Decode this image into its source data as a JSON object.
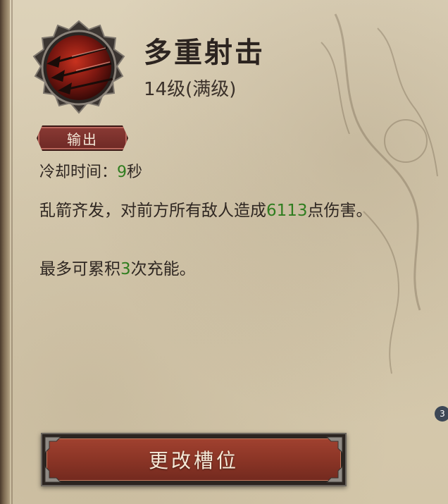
{
  "skill": {
    "name": "多重射击",
    "level_text": "14级(满级)",
    "tag": "输出",
    "cooldown_label": "冷却时间：",
    "cooldown_value": "9",
    "cooldown_unit": "秒",
    "description": {
      "pre": "乱箭齐发，对前方所有敌人造成",
      "damage": "6113",
      "post": "点伤害。"
    },
    "charges": {
      "pre": "最多可累积",
      "value": "3",
      "post": "次充能。"
    },
    "icon": "multishot-arrows-icon"
  },
  "badge": "3",
  "action_button": {
    "label": "更改槽位"
  },
  "colors": {
    "highlight_green": "#2f7d1f",
    "button_red": "#8b3526",
    "parchment": "#d7cbb0"
  }
}
